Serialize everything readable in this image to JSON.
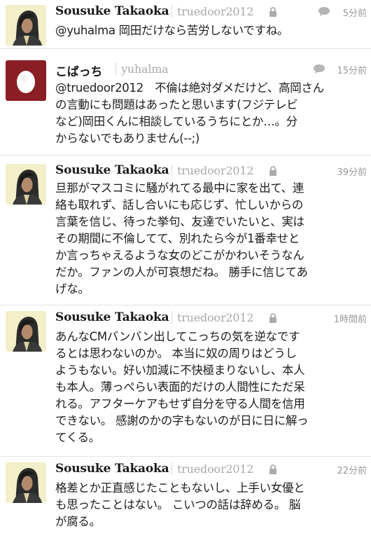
{
  "tweets": [
    {
      "avatar": "hooded-person-avatar",
      "name": "Sousuke Takaoka",
      "handle": "truedoor2012",
      "locked": true,
      "has_reply_icon": true,
      "time": "5分前",
      "lines": [
        "@yuhalma 岡田だけなら苦労しないですね。"
      ]
    },
    {
      "avatar": "egg-avatar",
      "name": "こばっち",
      "handle": "yuhalma",
      "locked": false,
      "has_reply_icon": true,
      "time": "15分前",
      "lines": [
        "@truedoor2012　不倫は絶対ダメだけど、高岡さん",
        "の言動にも問題はあったと思います(フジテレビ",
        "など)岡田くんに相談しているうちにとか…。分",
        "からないでもありません(--;)"
      ]
    },
    {
      "avatar": "hooded-person-avatar",
      "name": "Sousuke Takaoka",
      "handle": "truedoor2012",
      "locked": true,
      "has_reply_icon": false,
      "time": "39分前",
      "lines": [
        "旦那がマスコミに騒がれてる最中に家を出て、連",
        "絡も取れず、話し合いにも応じず、忙しいからの",
        "言葉を信じ、待った挙句、友達でいたいと、実は",
        "その期間に不倫してて、別れたら今が1番幸せと",
        "か言っちゃえるような女のどこがかわいそうなん",
        "だか。ファンの人が可哀想だね。 勝手に信じてあ",
        "げな。"
      ]
    },
    {
      "avatar": "hooded-person-avatar",
      "name": "Sousuke Takaoka",
      "handle": "truedoor2012",
      "locked": true,
      "has_reply_icon": false,
      "time": "1時間前",
      "lines": [
        "あんなCMバンバン出してこっちの気を逆なです",
        "るとは思わないのか。 本当に奴の周りはどうし",
        "ようもない。好い加減に不快極まりないし、本人",
        "も本人。薄っぺらい表面的だけの人間性にただ呆",
        "れる。アフターケアもせず自分を守る人間を信用",
        "できない。 感謝のかの字もないのが日に日に解っ",
        "てくる。"
      ]
    },
    {
      "avatar": "hooded-person-avatar",
      "name": "Sousuke Takaoka",
      "handle": "truedoor2012",
      "locked": true,
      "has_reply_icon": false,
      "time": "22分前",
      "lines": [
        "格差とか正直感じたこともないし、上手い女優と",
        "も思ったことはない。 こいつの話は辞める。 脳",
        "が腐る。"
      ]
    }
  ]
}
